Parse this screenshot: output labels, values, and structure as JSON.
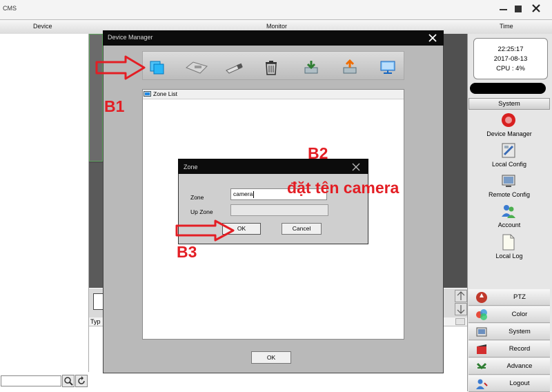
{
  "app": {
    "title": "CMS"
  },
  "header": {
    "device": "Device",
    "monitor": "Monitor",
    "time": "Time"
  },
  "clock": {
    "time": "22:25:17",
    "date": "2017-08-13",
    "cpu": "CPU : 4%"
  },
  "grid": {
    "type_col": "Typ"
  },
  "sidebar": {
    "section": "System",
    "items": [
      {
        "label": "Device Manager",
        "icon": "device-manager-icon"
      },
      {
        "label": "Local Config",
        "icon": "local-config-icon"
      },
      {
        "label": "Remote Config",
        "icon": "remote-config-icon"
      },
      {
        "label": "Account",
        "icon": "account-icon"
      },
      {
        "label": "Local Log",
        "icon": "local-log-icon"
      }
    ],
    "bottom": [
      {
        "label": "PTZ",
        "icon": "ptz-icon"
      },
      {
        "label": "Color",
        "icon": "color-icon"
      },
      {
        "label": "System",
        "icon": "system-icon"
      },
      {
        "label": "Record",
        "icon": "record-icon"
      },
      {
        "label": "Advance",
        "icon": "advance-icon"
      },
      {
        "label": "Logout",
        "icon": "logout-icon"
      }
    ]
  },
  "device_manager": {
    "title": "Device Manager",
    "toolbar_icons": [
      "add-zone-icon",
      "add-device-icon",
      "edit-icon",
      "delete-icon",
      "import-icon",
      "export-icon",
      "network-search-icon"
    ],
    "zone_list_label": "Zone List",
    "ok_label": "OK"
  },
  "zone_dialog": {
    "title": "Zone",
    "zone_label": "Zone",
    "zone_value": "camera",
    "upzone_label": "Up Zone",
    "ok_label": "OK",
    "cancel_label": "Cancel"
  },
  "annotations": {
    "b1": "B1",
    "b2": "B2",
    "b2_note": "đặt tên camera",
    "b3": "B3"
  },
  "colors": {
    "annotation": "#e31e24",
    "titlebar": "#0c0c0c"
  }
}
